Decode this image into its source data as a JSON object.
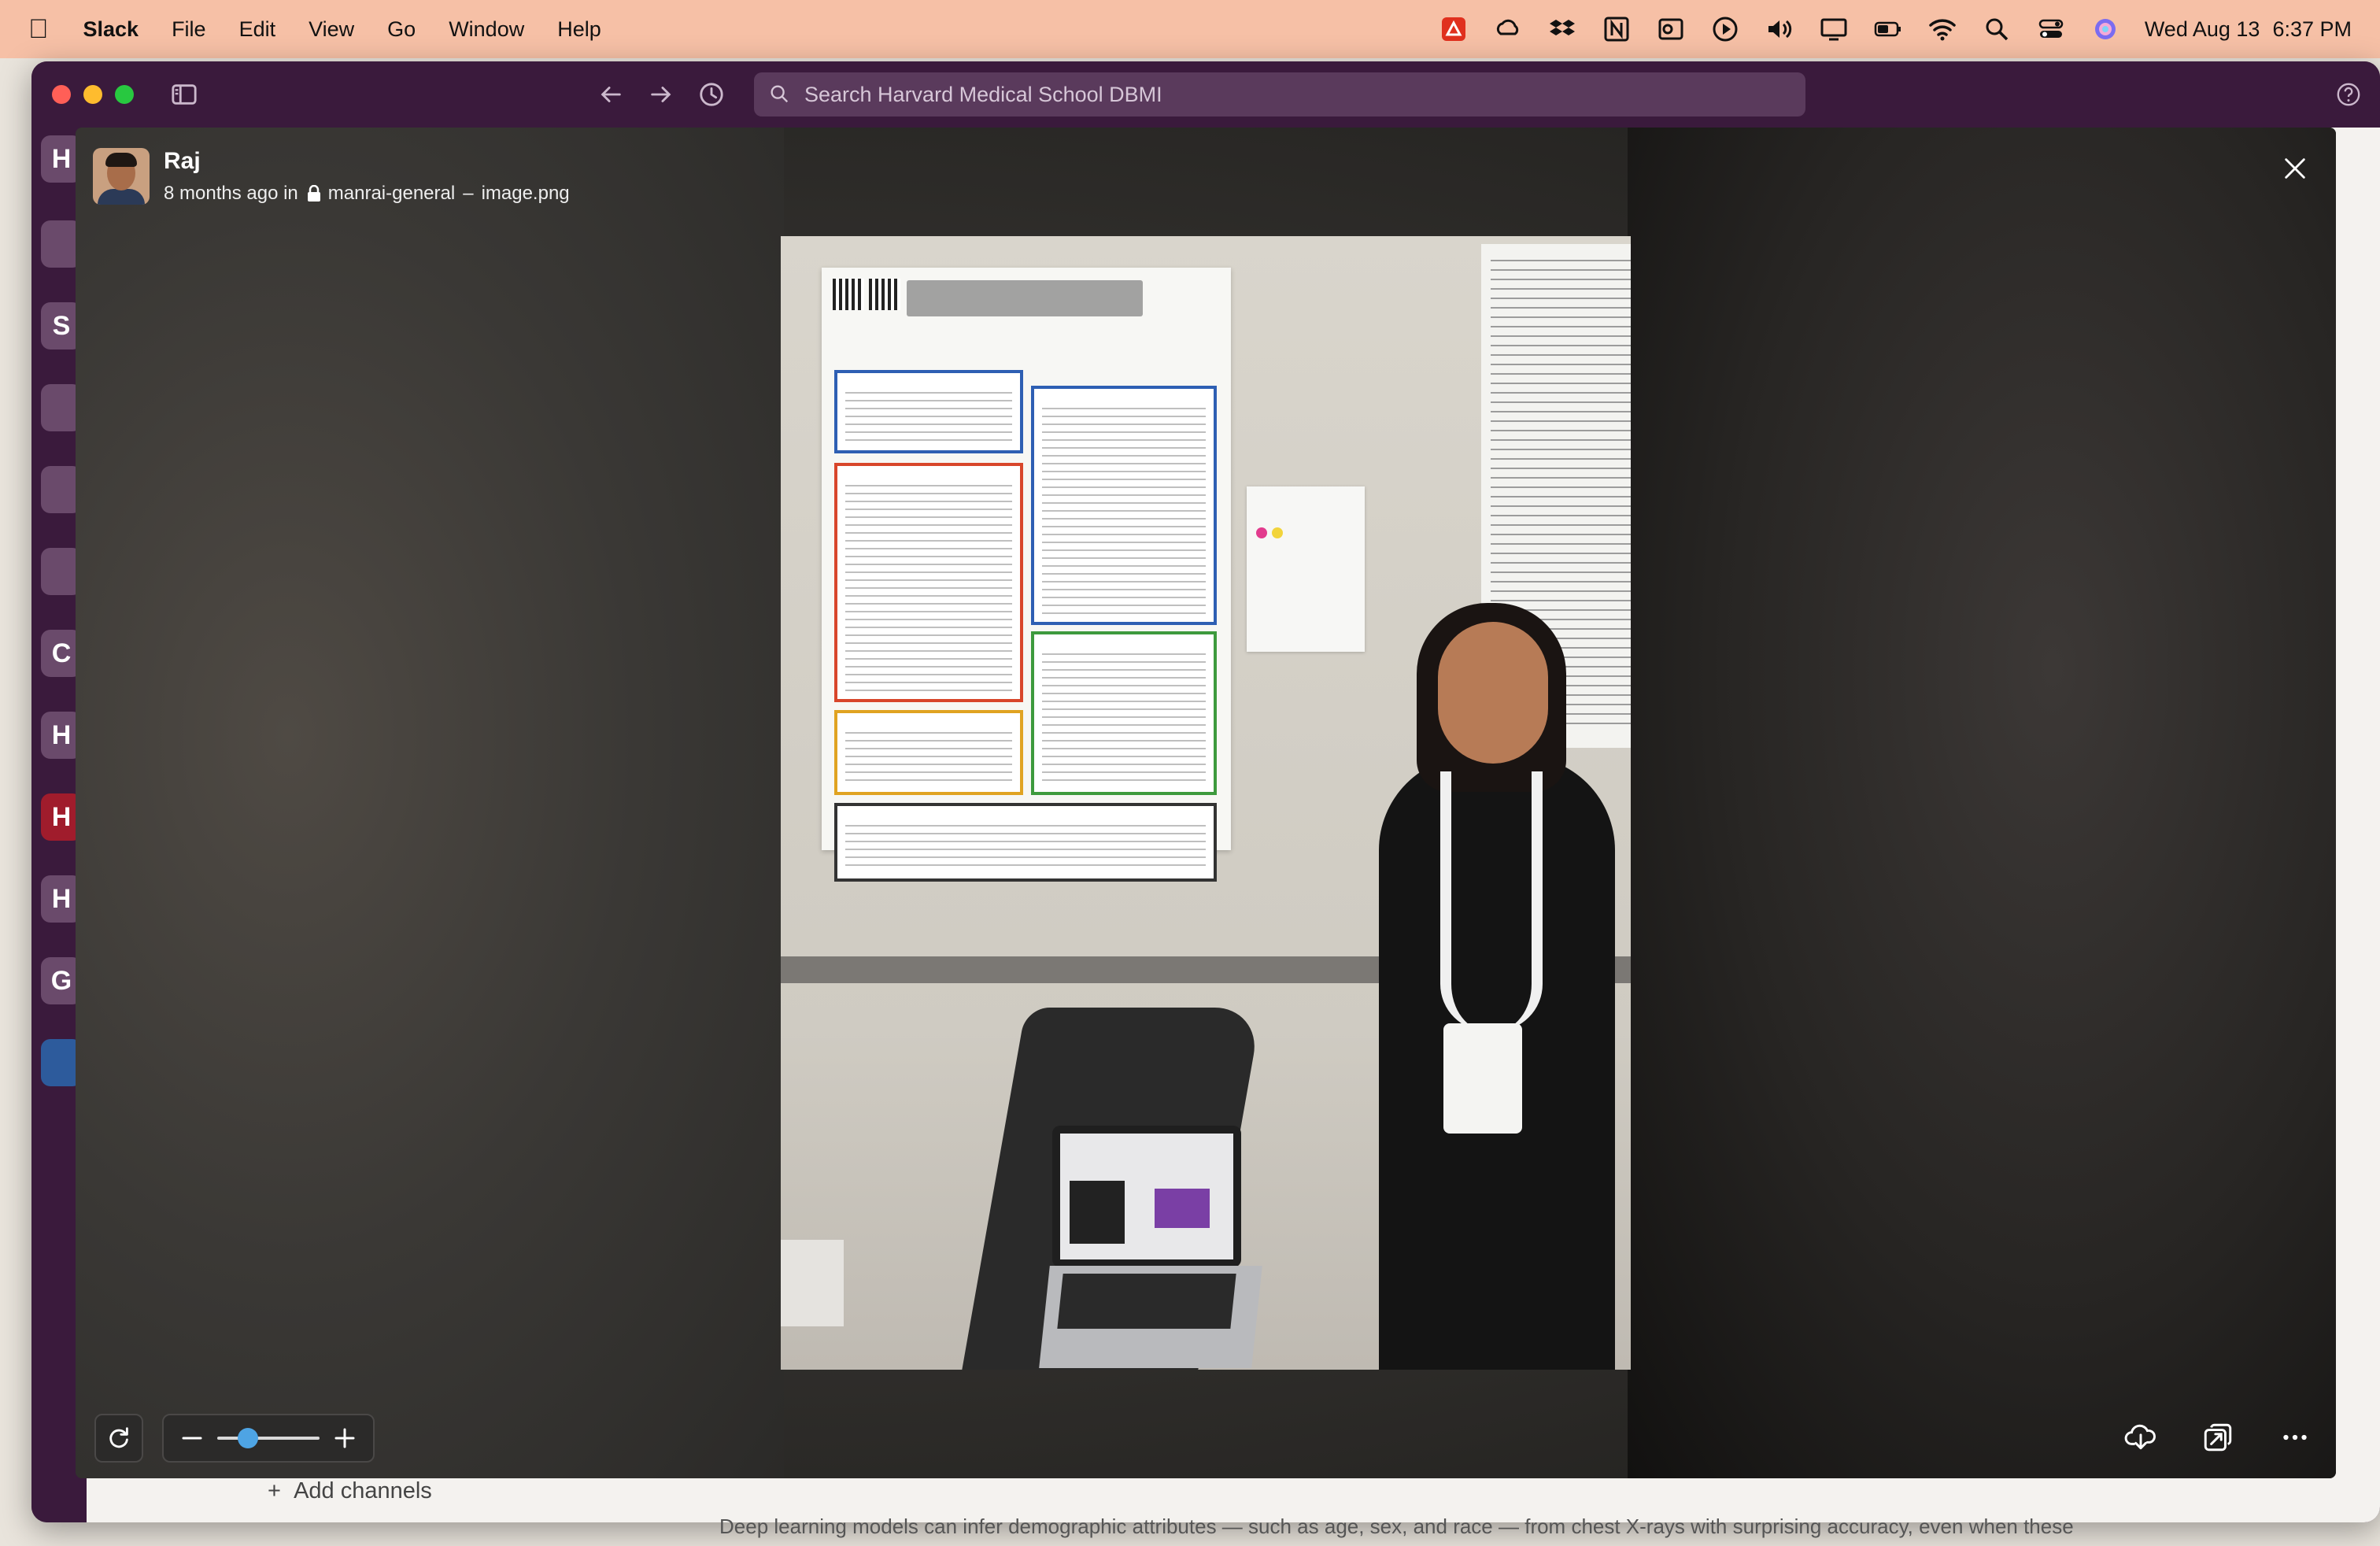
{
  "menubar": {
    "app_name": "Slack",
    "menus": [
      "File",
      "Edit",
      "View",
      "Go",
      "Window",
      "Help"
    ],
    "status_icons": [
      "acrobat-icon",
      "creative-cloud-icon",
      "dropbox-icon",
      "notion-icon",
      "outlook-icon",
      "play-icon",
      "volume-icon",
      "display-icon",
      "battery-icon",
      "wifi-icon",
      "spotlight-icon",
      "control-center-icon",
      "siri-icon"
    ],
    "date": "Wed Aug 13",
    "time": "6:37 PM"
  },
  "window": {
    "search_placeholder": "Search Harvard Medical School DBMI",
    "rail_letters": [
      "H",
      "S",
      "C",
      "H",
      "H",
      "H",
      "G"
    ],
    "add_channels": "Add channels",
    "background_caption": "Deep learning models can infer demographic attributes — such as age, sex, and race — from chest X-rays with surprising accuracy, even when these"
  },
  "lightbox": {
    "author": "Raj",
    "time_ago": "8 months ago in",
    "channel": "manrai-general",
    "separator": "–",
    "filename": "image.png",
    "zoom_level": 0.25
  },
  "colors": {
    "slack_aubergine": "#3a1a3c",
    "menubar_bg": "#f6c0a6",
    "slider_accent": "#4ea4e4"
  }
}
